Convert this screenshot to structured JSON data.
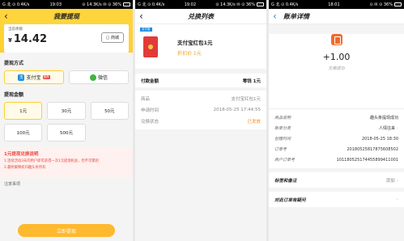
{
  "panel1": {
    "status": {
      "left": "G 北 ⊙ 0.4K/s",
      "time": "19:03",
      "right": "⊙ 14.3K/s ✉ ⊙ 36%"
    },
    "title": "我要提现",
    "balance_label": "当前余额",
    "balance_currency": "¥",
    "balance": "14.42",
    "mall_button": "商城",
    "method_title": "提现方式",
    "methods": [
      {
        "label": "支付宝",
        "badge": "推荐",
        "icon": "alipay-icon",
        "selected": true
      },
      {
        "label": "微信",
        "icon": "wechat-icon",
        "selected": false
      }
    ],
    "amount_title": "提现金额",
    "amounts": [
      "1元",
      "30元",
      "50元",
      "100元",
      "500元"
    ],
    "notice_title": "1元提现兑换说明",
    "notice_items": [
      "1.连续活动3天的用户即可获得一次1元提现机会，但不可累积",
      "2.最终解释权归趣头条所有"
    ],
    "note_label": "注意事项",
    "submit": "立即提现",
    "accent": "#ffcf2e"
  },
  "panel2": {
    "status": {
      "left": "G 北 ⊙ 0.4K/s",
      "time": "19:02",
      "right": "⊙ 14.3K/s ✉ ⊙ 36%"
    },
    "title": "兑换列表",
    "tag": "支付宝",
    "prize_name": "支付宝红包1元",
    "prize_price": "折扣价 1元",
    "pay_label": "付款金额",
    "pay_value": "零钱 1元",
    "rows": [
      {
        "k": "商品",
        "v": "支付宝红包1元"
      },
      {
        "k": "申请时间",
        "v": "2018-05-25 17:44:55"
      },
      {
        "k": "兑换状态",
        "v": "已发放"
      }
    ]
  },
  "panel3": {
    "status": {
      "left": "G 北 ⊙ 0.4K/s",
      "time": "18:01",
      "right": "⊙ ✉ ⊙ 36%"
    },
    "title": "账单详情",
    "amount": "+1.00",
    "amount_status": "交易成功",
    "details": [
      {
        "k": "商品说明",
        "v": "趣头条提现成功"
      },
      {
        "k": "账单分类",
        "v": "人情往来",
        "arrow": true
      },
      {
        "k": "创建时间",
        "v": "2018-05-25 18:30"
      },
      {
        "k": "订单号",
        "v": "20180525817875608502"
      },
      {
        "k": "商户订单号",
        "v": "101180525174455899411001"
      }
    ],
    "tag_row": {
      "k": "标签和备注",
      "v": "添加"
    },
    "question_row": {
      "k": "对此订单有疑问"
    }
  }
}
